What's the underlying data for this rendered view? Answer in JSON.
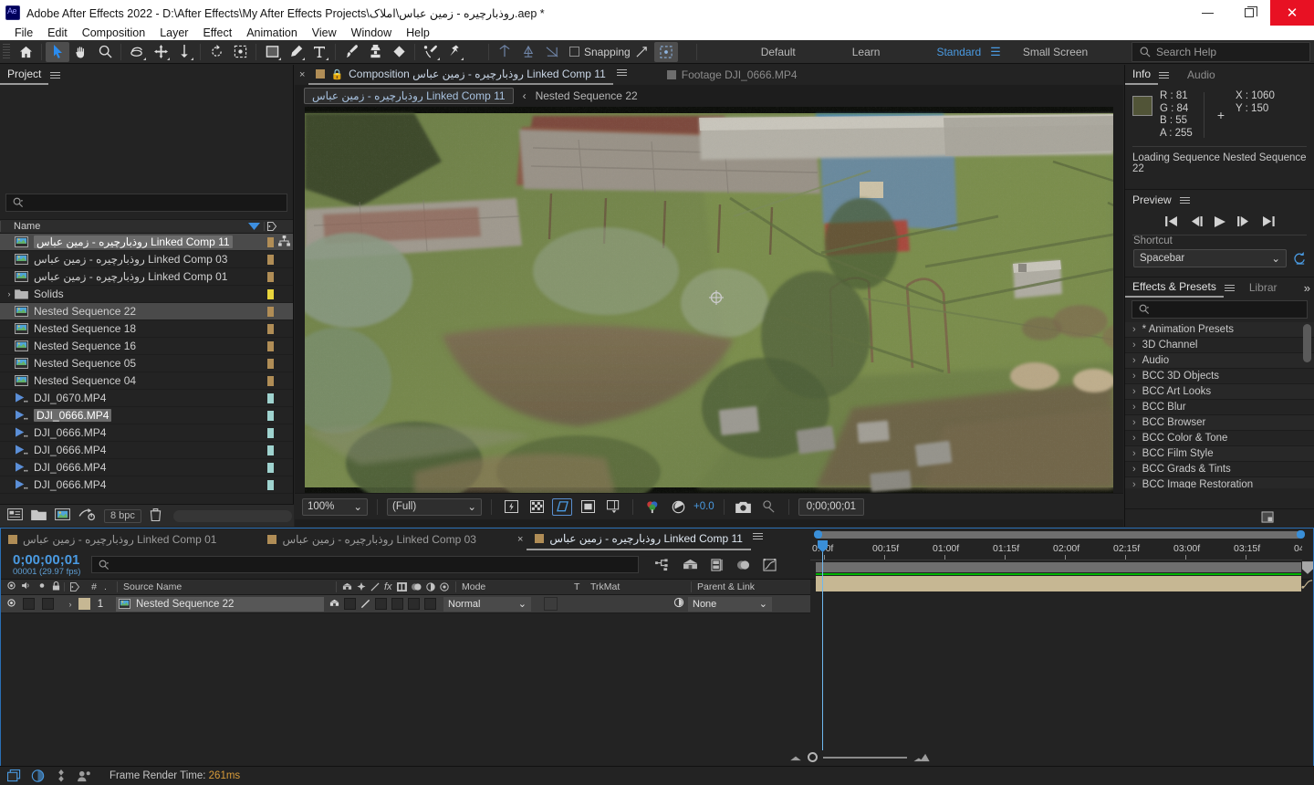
{
  "window": {
    "title": "Adobe After Effects 2022 - D:\\After Effects\\My After Effects Projects\\روذبارچیره - زمین عباس\\املاک.aep *",
    "logo": "ae-logo",
    "minimize": "–",
    "maximize": "❐",
    "close": "✕"
  },
  "menu": [
    "File",
    "Edit",
    "Composition",
    "Layer",
    "Effect",
    "Animation",
    "View",
    "Window",
    "Help"
  ],
  "toolbar": {
    "tools": [
      "home-icon",
      "selection-tool",
      "hand-tool",
      "zoom-tool",
      "rotation-tool",
      "unified-camera-tool",
      "pan-behind-tool",
      "rotate-tool",
      "region-of-interest-tool",
      "shape-tool",
      "pen-tool",
      "type-tool",
      "brush-tool",
      "clone-stamp-tool",
      "eraser-tool",
      "roto-brush-tool",
      "puppet-pin-tool"
    ],
    "snapping_label": "Snapping",
    "workspaces": [
      "Default",
      "Learn",
      "Standard",
      "Small Screen"
    ],
    "active_workspace": "Standard",
    "overflow": "»",
    "search_help_placeholder": "Search Help"
  },
  "project": {
    "tab": "Project",
    "search_value": "",
    "columns": {
      "name": "Name",
      "sort": "▼",
      "tag": "tag-icon"
    },
    "items": [
      {
        "name": "روذبارچیره - زمین عباس Linked Comp 11",
        "type": "comp",
        "swatch": "#b08d56",
        "selected": true,
        "highlight": true,
        "network": true
      },
      {
        "name": "روذبارچیره - زمین عباس Linked Comp 03",
        "type": "comp",
        "swatch": "#b08d56"
      },
      {
        "name": "روذبارچیره - زمین عباس Linked Comp 01",
        "type": "comp",
        "swatch": "#b08d56"
      },
      {
        "name": "Solids",
        "type": "folder",
        "swatch": "#e8d43c",
        "twirl": "›"
      },
      {
        "name": "Nested Sequence 22",
        "type": "comp",
        "swatch": "#b08d56",
        "selected": true
      },
      {
        "name": "Nested Sequence 18",
        "type": "comp",
        "swatch": "#b08d56"
      },
      {
        "name": "Nested Sequence 16",
        "type": "comp",
        "swatch": "#b08d56"
      },
      {
        "name": "Nested Sequence 05",
        "type": "comp",
        "swatch": "#b08d56"
      },
      {
        "name": "Nested Sequence 04",
        "type": "comp",
        "swatch": "#b08d56"
      },
      {
        "name": "DJI_0670.MP4",
        "type": "footage",
        "swatch": "#9fd3cf"
      },
      {
        "name": "DJI_0666.MP4",
        "type": "footage",
        "swatch": "#9fd3cf",
        "highlight": true
      },
      {
        "name": "DJI_0666.MP4",
        "type": "footage",
        "swatch": "#9fd3cf"
      },
      {
        "name": "DJI_0666.MP4",
        "type": "footage",
        "swatch": "#9fd3cf"
      },
      {
        "name": "DJI_0666.MP4",
        "type": "footage",
        "swatch": "#9fd3cf"
      },
      {
        "name": "DJI_0666.MP4",
        "type": "footage",
        "swatch": "#9fd3cf"
      }
    ],
    "footer": {
      "bpc": "8 bpc",
      "icons": [
        "interpret-footage-icon",
        "new-folder-icon",
        "new-composition-icon",
        "project-settings-icon",
        "delete-icon"
      ]
    }
  },
  "composition": {
    "tabs": [
      {
        "label": "Composition روذبارچیره - زمین عباس Linked Comp 11",
        "active": true,
        "closable": true,
        "locked": true
      },
      {
        "label": "Footage DJI_0666.MP4",
        "active": false
      }
    ],
    "breadcrumb_current": "روذبارچیره - زمین عباس Linked Comp 11",
    "breadcrumb_chevron": "‹",
    "breadcrumb_next": "Nested Sequence 22",
    "footer": {
      "zoom": "100%",
      "resolution": "(Full)",
      "exposure": "+0.0",
      "timecode": "0;00;00;01",
      "buttons": [
        "fast-preview-icon",
        "transparency-grid-icon",
        "region-of-interest-icon",
        "mask-path-icon",
        "timeline-icon",
        "channel-icon",
        "exposure-icon",
        "snapshot-icon",
        "show-snapshot-icon"
      ]
    }
  },
  "info": {
    "tabs": [
      "Info",
      "Audio"
    ],
    "active_tab": "Info",
    "color_swatch": "#515437",
    "R": "R : 81",
    "G": "G : 84",
    "B": "B : 55",
    "A": "A : 255",
    "X": "X : 1060",
    "Y": "Y : 150",
    "status": "Loading Sequence Nested Sequence 22"
  },
  "preview": {
    "tab": "Preview",
    "controls": [
      "first-frame-icon",
      "previous-frame-icon",
      "play-icon",
      "next-frame-icon",
      "last-frame-icon"
    ],
    "shortcut_label": "Shortcut",
    "shortcut_value": "Spacebar",
    "reset_icon": "reset-icon"
  },
  "effects": {
    "tabs": [
      "Effects & Presets",
      "Librar"
    ],
    "active_tab": "Effects & Presets",
    "search_value": "",
    "items": [
      "* Animation Presets",
      "3D Channel",
      "Audio",
      "BCC 3D Objects",
      "BCC Art Looks",
      "BCC Blur",
      "BCC Browser",
      "BCC Color & Tone",
      "BCC Film Style",
      "BCC Grads & Tints",
      "BCC Image Restoration"
    ]
  },
  "timeline": {
    "tabs": [
      {
        "label": "روذبارچیره - زمین عباس Linked Comp 01",
        "active": false
      },
      {
        "label": "روذبارچیره - زمین عباس Linked Comp 03",
        "active": false
      },
      {
        "label": "روذبارچیره - زمین عباس Linked Comp 11",
        "active": true,
        "closable": true
      }
    ],
    "current_time": "0;00;00;01",
    "frame_info": "00001 (29.97 fps)",
    "search_value": "",
    "toolbar_icons": [
      "composition-mini-flowchart-icon",
      "draft-3d-icon",
      "hide-shy-layers-icon",
      "frame-blending-icon",
      "motion-blur-icon",
      "graph-editor-icon"
    ],
    "columns": [
      "Source Name",
      "Mode",
      "T",
      "TrkMat",
      "Parent & Link"
    ],
    "switch_headers": [
      "video-icon",
      "audio-icon",
      "solo-icon",
      "lock-icon",
      "label-icon",
      "#"
    ],
    "layers": [
      {
        "index": "1",
        "name": "Nested Sequence 22",
        "mode": "Normal",
        "trkmat": "",
        "parent": "None",
        "label_color": "#c6b793"
      }
    ],
    "ruler_labels": [
      "0:00f",
      "00:15f",
      "01:00f",
      "01:15f",
      "02:00f",
      "02:15f",
      "03:00f",
      "03:15f",
      "04"
    ]
  },
  "status": {
    "icons": [
      "render-queue-icon",
      "adobe-media-encoder-icon",
      "puppet-icon",
      "collaborate-icon"
    ],
    "frame_render_label": "Frame Render Time:",
    "frame_render_value": "261ms"
  }
}
